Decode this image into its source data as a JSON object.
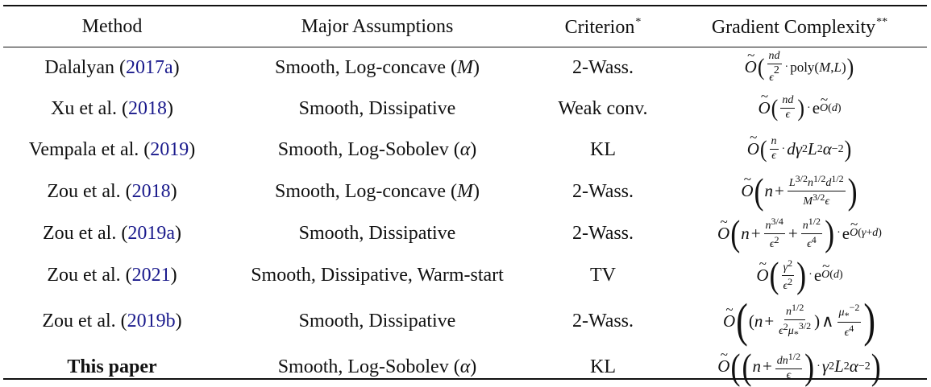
{
  "table": {
    "headers": {
      "method": "Method",
      "assumptions": "Major Assumptions",
      "criterion": "Criterion",
      "criterion_mark": "*",
      "complexity": "Gradient Complexity",
      "complexity_mark": "**"
    },
    "rows": [
      {
        "author": "Dalalyan (",
        "cite": "2017a",
        "close": ")",
        "assumptions": "Smooth, Log-concave (",
        "assumption_param": "M",
        "assumption_close": ")",
        "criterion": "2-Wass."
      },
      {
        "author": "Xu et al. (",
        "cite": "2018",
        "close": ")",
        "assumptions": "Smooth, Dissipative",
        "assumption_param": "",
        "assumption_close": "",
        "criterion": "Weak conv."
      },
      {
        "author": "Vempala et al. (",
        "cite": "2019",
        "close": ")",
        "assumptions": "Smooth, Log-Sobolev (",
        "assumption_param": "α",
        "assumption_close": ")",
        "criterion": "KL"
      },
      {
        "author": "Zou et al. (",
        "cite": "2018",
        "close": ")",
        "assumptions": "Smooth, Log-concave (",
        "assumption_param": "M",
        "assumption_close": ")",
        "criterion": "2-Wass."
      },
      {
        "author": "Zou et al. (",
        "cite": "2019a",
        "close": ")",
        "assumptions": "Smooth, Dissipative",
        "assumption_param": "",
        "assumption_close": "",
        "criterion": "2-Wass."
      },
      {
        "author": "Zou et al. (",
        "cite": "2021",
        "close": ")",
        "assumptions": "Smooth, Dissipative, Warm-start",
        "assumption_param": "",
        "assumption_close": "",
        "criterion": "TV"
      },
      {
        "author": "Zou et al. (",
        "cite": "2019b",
        "close": ")",
        "assumptions": "Smooth, Dissipative",
        "assumption_param": "",
        "assumption_close": "",
        "criterion": "2-Wass."
      },
      {
        "author": "This paper",
        "cite": "",
        "close": "",
        "assumptions": "Smooth, Log-Sobolev (",
        "assumption_param": "α",
        "assumption_close": ")",
        "criterion": "KL"
      }
    ],
    "complexities": [
      "Õ( nd/ε² · poly(M,L) )",
      "Õ( nd/ε ) · e^{Õ(d)}",
      "Õ( n/ε · dγ²L²α⁻² )",
      "Õ( n + L^{3/2}n^{1/2}d^{1/2} / (M^{3/2}ε) )",
      "Õ( n + n^{3/4}/ε² + n^{1/2}/ε⁴ ) · e^{Õ(γ+d)}",
      "Õ( γ²/ε² ) · e^{Õ(d)}",
      "Õ( (n + n^{1/2}/(ε²μ_*^{3/2})) ∧ μ_*^{-2}/ε⁴ )",
      "Õ( (n + dn^{1/2}/ε) · γ²L²α⁻² )"
    ]
  }
}
